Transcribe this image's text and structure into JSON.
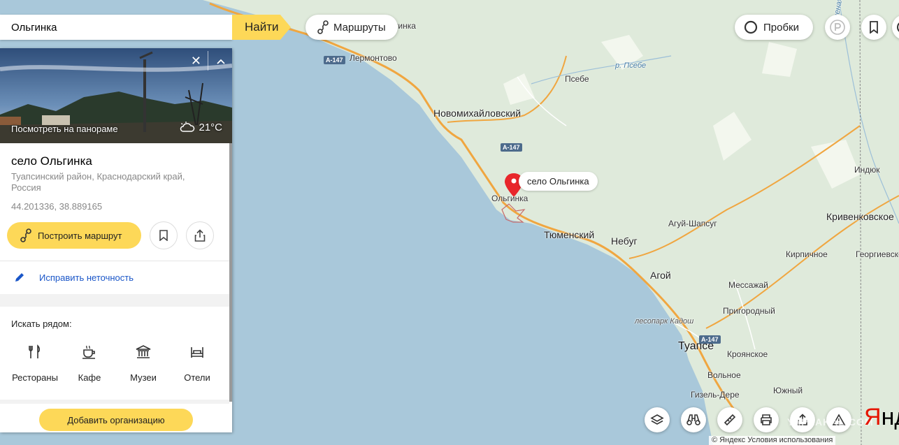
{
  "search": {
    "value": "Ольгинка",
    "button": "Найти"
  },
  "top": {
    "routes_label": "Маршруты",
    "traffic_label": "Пробки"
  },
  "panel": {
    "panorama_label": "Посмотреть на панораме",
    "temperature": "21°C",
    "title": "село Ольгинка",
    "address": "Туапсинский район, Краснодарский край, Россия",
    "coordinates": "44.201336, 38.889165",
    "route_button": "Построить маршрут",
    "fix_link": "Исправить неточность",
    "nearby_title": "Искать рядом:",
    "nearby": [
      {
        "label": "Рестораны",
        "icon": "fork-knife-icon"
      },
      {
        "label": "Кафе",
        "icon": "coffee-cup-icon"
      },
      {
        "label": "Музеи",
        "icon": "museum-icon"
      },
      {
        "label": "Отели",
        "icon": "bed-icon"
      }
    ],
    "add_org": "Добавить организацию"
  },
  "map": {
    "marker_label": "село Ольгинка",
    "places": {
      "olginka_top": "гинка",
      "lermontovo": "Лермонтово",
      "psebe": "Псебе",
      "r_psebe": "р. Псебе",
      "novomikhailovsky": "Новомихайловский",
      "olginka": "Ольгинка",
      "tyumensky": "Тюменский",
      "nebug": "Небуг",
      "agui_shapsug": "Агуй-Шапсуг",
      "agoy": "Агой",
      "indyuk": "Индюк",
      "krivenkovskoe": "Кривенковское",
      "kirpichnoe": "Кирпичное",
      "georgievskoe": "Георгиевское",
      "messazhai": "Мессажай",
      "prigorodny": "Пригородный",
      "lesopark": "лесопарк Кадош",
      "tuapse": "Туапсе",
      "kroyanskoe": "Кроянское",
      "volnoe": "Вольное",
      "yuzhny": "Южный",
      "gizel_dere": "Гизель-Дере",
      "r_pshenakho": "р. Пшенахо"
    },
    "road": "A-147"
  },
  "footer": "© Яндекс Условия использования",
  "watermark": "YAPLAKAL.COM",
  "brand": {
    "first": "Я",
    "rest": "нде"
  },
  "colors": {
    "sea": "#a9c8da",
    "land": "#dfeadb",
    "road": "#f0a640",
    "accent": "#fdd858",
    "marker": "#e8262b",
    "link": "#1a56c8"
  }
}
